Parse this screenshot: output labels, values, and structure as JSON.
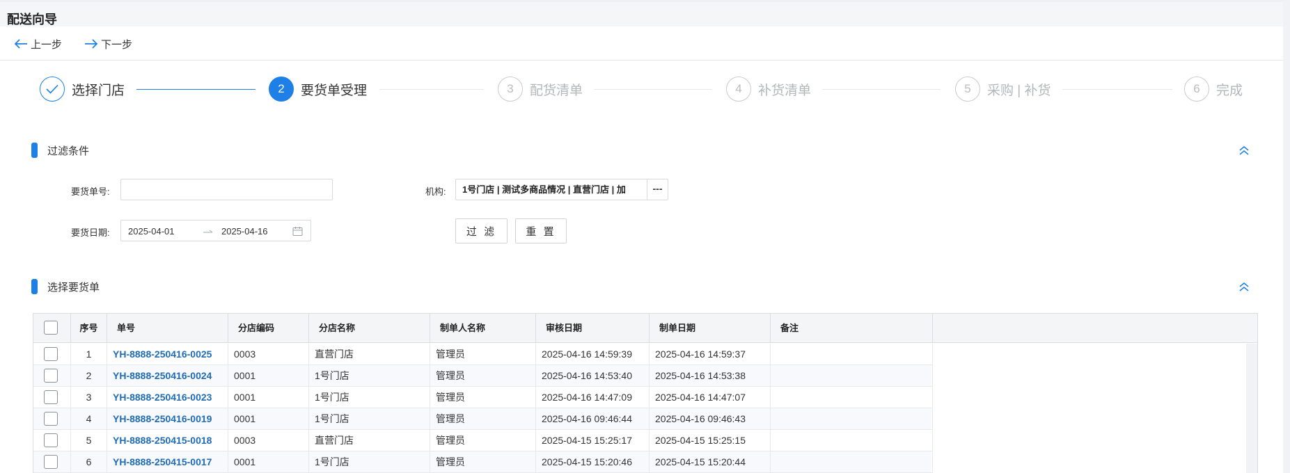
{
  "page": {
    "title": "配送向导"
  },
  "toolbar": {
    "prev_label": "上一步",
    "next_label": "下一步"
  },
  "steps": [
    {
      "index": "1",
      "label": "选择门店",
      "state": "done"
    },
    {
      "index": "2",
      "label": "要货单受理",
      "state": "active"
    },
    {
      "index": "3",
      "label": "配货清单",
      "state": "pending"
    },
    {
      "index": "4",
      "label": "补货清单",
      "state": "pending"
    },
    {
      "index": "5",
      "label": "采购 | 补货",
      "state": "pending"
    },
    {
      "index": "6",
      "label": "完成",
      "state": "pending"
    }
  ],
  "filter": {
    "title": "过滤条件",
    "order_no_label": "要货单号:",
    "order_no_value": "",
    "org_label": "机构:",
    "org_value": "1号门店 | 测试多商品情况 | 直营门店 | 加",
    "org_more": "---",
    "date_label": "要货日期:",
    "date_from": "2025-04-01",
    "date_to": "2025-04-16",
    "filter_button": "过 滤",
    "reset_button": "重 置"
  },
  "orders": {
    "title": "选择要货单",
    "columns": {
      "seq": "序号",
      "bill_no": "单号",
      "store_code": "分店编码",
      "store_name": "分店名称",
      "maker": "制单人名称",
      "audit_date": "审核日期",
      "make_date": "制单日期",
      "remark": "备注"
    },
    "rows": [
      {
        "seq": "1",
        "bill_no": "YH-8888-250416-0025",
        "store_code": "0003",
        "store_name": "直营门店",
        "maker": "管理员",
        "audit_date": "2025-04-16 14:59:39",
        "make_date": "2025-04-16 14:59:37",
        "remark": ""
      },
      {
        "seq": "2",
        "bill_no": "YH-8888-250416-0024",
        "store_code": "0001",
        "store_name": "1号门店",
        "maker": "管理员",
        "audit_date": "2025-04-16 14:53:40",
        "make_date": "2025-04-16 14:53:38",
        "remark": ""
      },
      {
        "seq": "3",
        "bill_no": "YH-8888-250416-0023",
        "store_code": "0001",
        "store_name": "1号门店",
        "maker": "管理员",
        "audit_date": "2025-04-16 14:47:09",
        "make_date": "2025-04-16 14:47:07",
        "remark": ""
      },
      {
        "seq": "4",
        "bill_no": "YH-8888-250416-0019",
        "store_code": "0001",
        "store_name": "1号门店",
        "maker": "管理员",
        "audit_date": "2025-04-16 09:46:44",
        "make_date": "2025-04-16 09:46:43",
        "remark": ""
      },
      {
        "seq": "5",
        "bill_no": "YH-8888-250415-0018",
        "store_code": "0003",
        "store_name": "直营门店",
        "maker": "管理员",
        "audit_date": "2025-04-15 15:25:17",
        "make_date": "2025-04-15 15:25:15",
        "remark": ""
      },
      {
        "seq": "6",
        "bill_no": "YH-8888-250415-0017",
        "store_code": "0001",
        "store_name": "1号门店",
        "maker": "管理员",
        "audit_date": "2025-04-15 15:20:46",
        "make_date": "2025-04-15 15:20:44",
        "remark": ""
      }
    ]
  },
  "colors": {
    "accent": "#1e7fe6",
    "link": "#1f6bb5"
  }
}
